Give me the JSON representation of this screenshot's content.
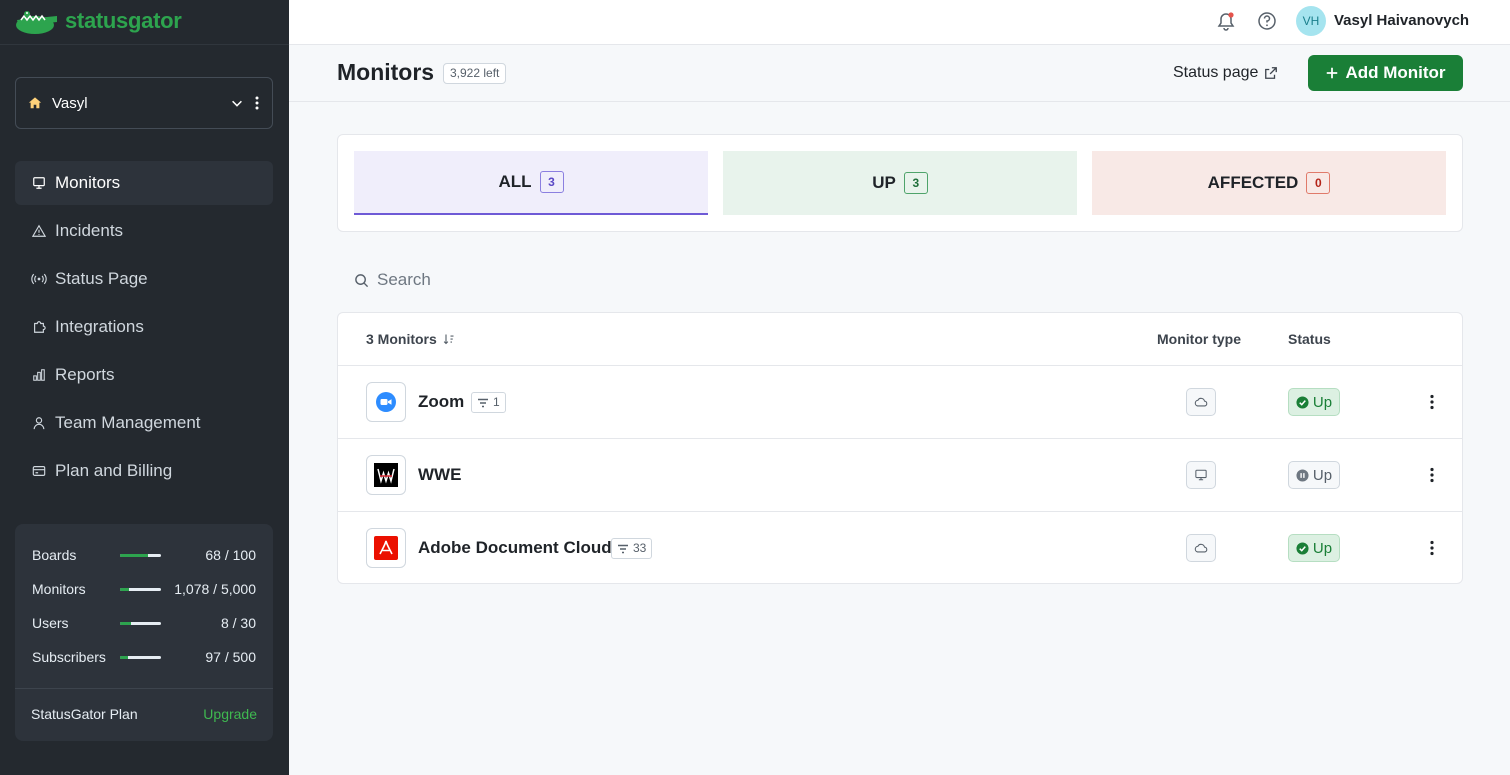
{
  "brand": {
    "name": "statusgator",
    "color": "#2da44e"
  },
  "workspace": {
    "name": "Vasyl"
  },
  "nav": [
    {
      "label": "Monitors",
      "icon": "monitor-icon",
      "active": true
    },
    {
      "label": "Incidents",
      "icon": "warning-icon"
    },
    {
      "label": "Status Page",
      "icon": "broadcast-icon"
    },
    {
      "label": "Integrations",
      "icon": "puzzle-icon"
    },
    {
      "label": "Reports",
      "icon": "bar-chart-icon"
    },
    {
      "label": "Team Management",
      "icon": "user-icon"
    },
    {
      "label": "Plan and Billing",
      "icon": "credit-card-icon"
    }
  ],
  "usage": [
    {
      "label": "Boards",
      "value": "68 / 100",
      "fraction": 0.68
    },
    {
      "label": "Monitors",
      "value": "1,078 / 5,000",
      "fraction": 0.22
    },
    {
      "label": "Users",
      "value": "8 / 30",
      "fraction": 0.27
    },
    {
      "label": "Subscribers",
      "value": "97 / 500",
      "fraction": 0.19
    }
  ],
  "plan": {
    "name": "StatusGator Plan",
    "upgrade_label": "Upgrade"
  },
  "topbar": {
    "avatar_initials": "VH",
    "user_name": "Vasyl Haivanovych"
  },
  "header": {
    "title": "Monitors",
    "left_badge": "3,922 left",
    "status_page_label": "Status page",
    "add_monitor_label": "Add Monitor"
  },
  "filters": [
    {
      "label": "ALL",
      "count": "3"
    },
    {
      "label": "UP",
      "count": "3"
    },
    {
      "label": "AFFECTED",
      "count": "0"
    }
  ],
  "search": {
    "placeholder": "Search"
  },
  "table": {
    "count_label": "3 Monitors",
    "col_type": "Monitor type",
    "col_status": "Status",
    "rows": [
      {
        "name": "Zoom",
        "components": "1",
        "type_icon": "cloud-icon",
        "status": "Up",
        "status_kind": "up"
      },
      {
        "name": "WWE",
        "components": "",
        "type_icon": "desktop-icon",
        "status": "Up",
        "status_kind": "paused"
      },
      {
        "name": "Adobe Document Cloud",
        "components": "33",
        "type_icon": "cloud-icon",
        "status": "Up",
        "status_kind": "up"
      }
    ]
  }
}
